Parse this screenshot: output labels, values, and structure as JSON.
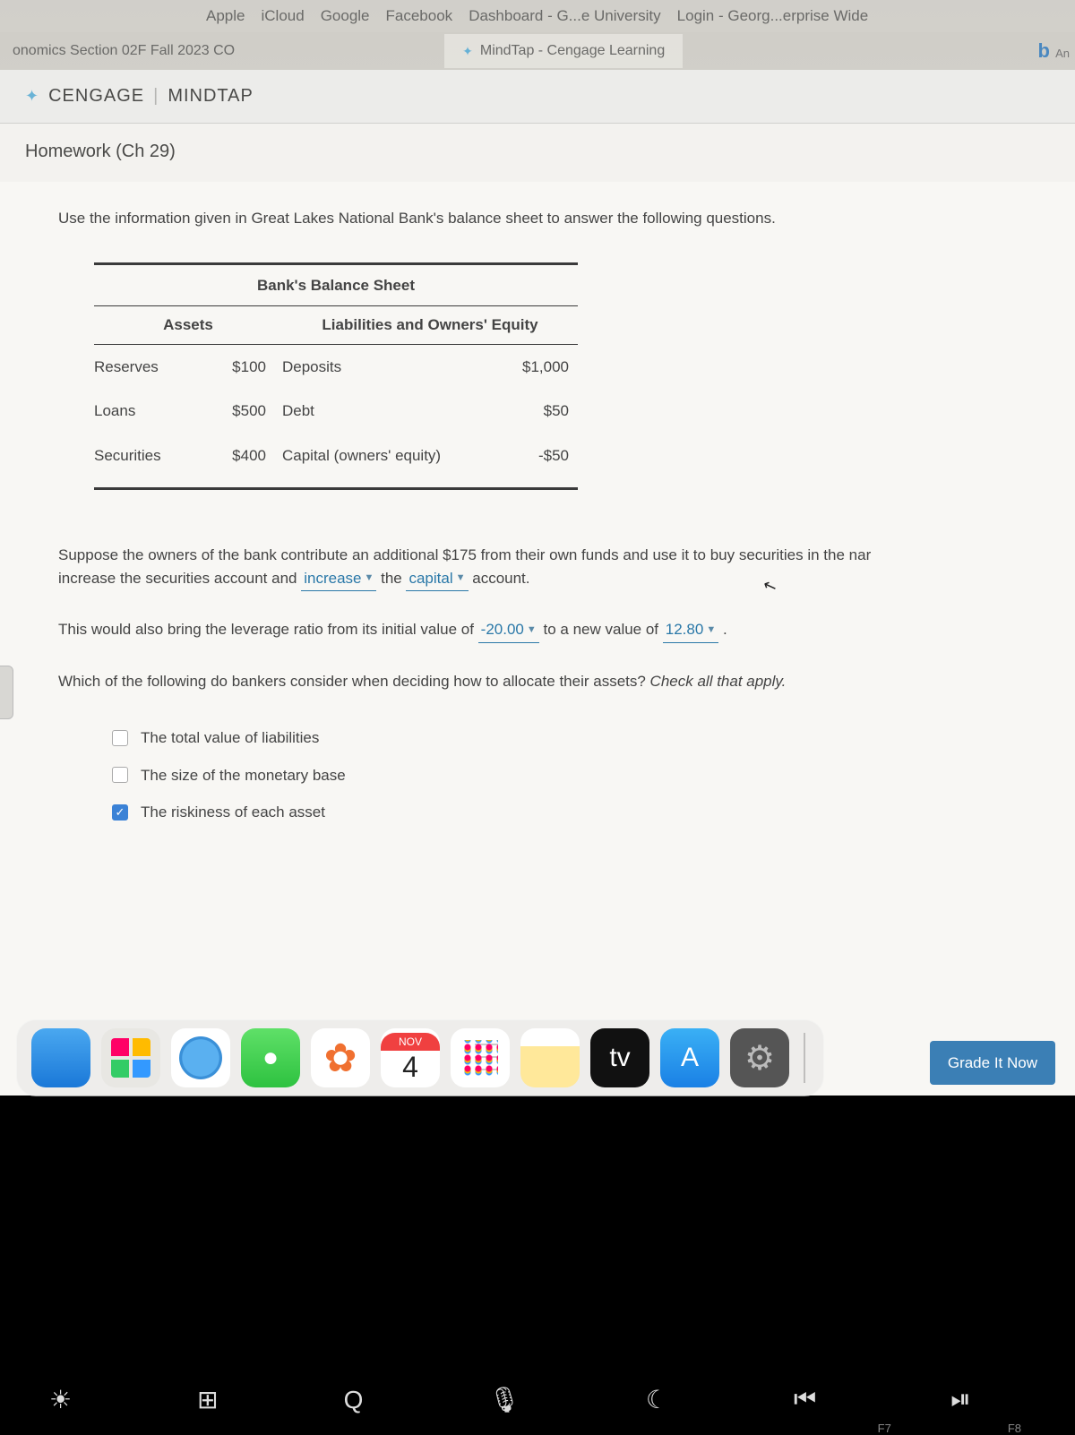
{
  "bookmarks": [
    "Apple",
    "iCloud",
    "Google",
    "Facebook",
    "Dashboard - G...e University",
    "Login - Georg...erprise Wide"
  ],
  "tabs": {
    "left": "onomics Section 02F Fall 2023 CO",
    "active": "MindTap - Cengage Learning",
    "right": "b",
    "right_sub": "An"
  },
  "brand": {
    "name": "CENGAGE",
    "product": "MINDTAP"
  },
  "assignment_title": "Homework (Ch 29)",
  "intro": "Use the information given in Great Lakes National Bank's balance sheet to answer the following questions.",
  "table": {
    "title": "Bank's Balance Sheet",
    "head_assets": "Assets",
    "head_liab": "Liabilities and Owners' Equity",
    "rows": [
      {
        "a": "Reserves",
        "av": "$100",
        "l": "Deposits",
        "lv": "$1,000"
      },
      {
        "a": "Loans",
        "av": "$500",
        "l": "Debt",
        "lv": "$50"
      },
      {
        "a": "Securities",
        "av": "$400",
        "l": "Capital (owners' equity)",
        "lv": "-$50"
      }
    ]
  },
  "q1": {
    "pre": "Suppose the owners of the bank contribute an additional $175 from their own funds and use it to buy securities in the nar",
    "line2a": "increase the securities account and ",
    "dd1": "increase",
    "mid": " the ",
    "dd2": "capital",
    "post": " account."
  },
  "q2": {
    "pre": "This would also bring the leverage ratio from its initial value of ",
    "dd1": "-20.00",
    "mid": " to a new value of ",
    "dd2": "12.80",
    "post": " ."
  },
  "q3": {
    "prompt": "Which of the following do bankers consider when deciding how to allocate their assets? ",
    "hint": "Check all that apply.",
    "options": [
      {
        "label": "The total value of liabilities",
        "checked": false
      },
      {
        "label": "The size of the monetary base",
        "checked": false
      },
      {
        "label": "The riskiness of each asset",
        "checked": true
      }
    ]
  },
  "grade_button": "Grade It Now",
  "dock": {
    "cal_month": "NOV",
    "cal_day": "4",
    "tv_label": "tv"
  },
  "touchbar": {
    "labels": [
      "F7",
      "F8"
    ]
  }
}
